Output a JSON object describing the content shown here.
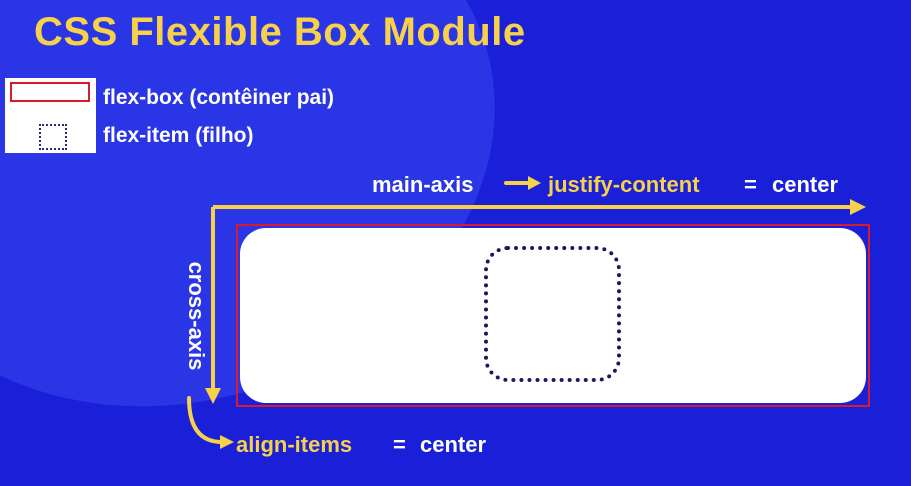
{
  "title": "CSS Flexible Box Module",
  "legend": {
    "container_label": "flex-box (contêiner pai)",
    "item_label": "flex-item (filho)"
  },
  "main_axis": {
    "axis_label": "main-axis",
    "property": "justify-content",
    "equals": "=",
    "value": "center"
  },
  "cross_axis": {
    "axis_label": "cross-axis",
    "property": "align-items",
    "equals": "=",
    "value": "center"
  },
  "colors": {
    "background": "#1a1fd8",
    "accent_yellow": "#f7d14a",
    "container_border": "#d81b2a",
    "item_border": "#1a1a5a",
    "text_white": "#ffffff"
  }
}
